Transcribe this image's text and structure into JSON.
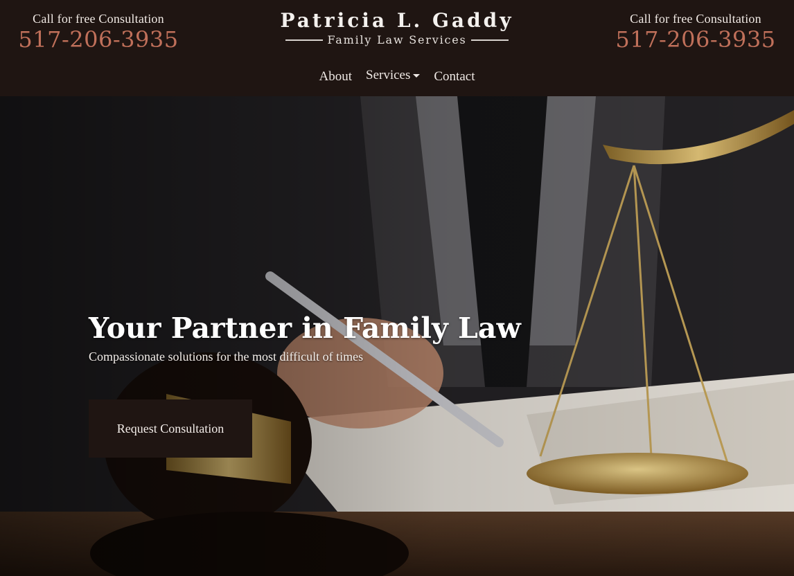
{
  "header": {
    "call_left": {
      "label": "Call for free Consultation",
      "phone": "517-206-3935"
    },
    "call_right": {
      "label": "Call for free Consultation",
      "phone": "517-206-3935"
    },
    "logo": {
      "name": "Patricia L. Gaddy",
      "subtitle": "Family Law Services"
    },
    "nav": {
      "about": "About",
      "services": "Services",
      "contact": "Contact"
    }
  },
  "hero": {
    "title": "Your Partner in Family Law",
    "subtitle": "Compassionate solutions for the most difficult of times",
    "cta_label": "Request Consultation"
  },
  "colors": {
    "header_bg": "#1f1512",
    "phone_accent": "#c0705a",
    "cta_bg": "#1f1512"
  }
}
